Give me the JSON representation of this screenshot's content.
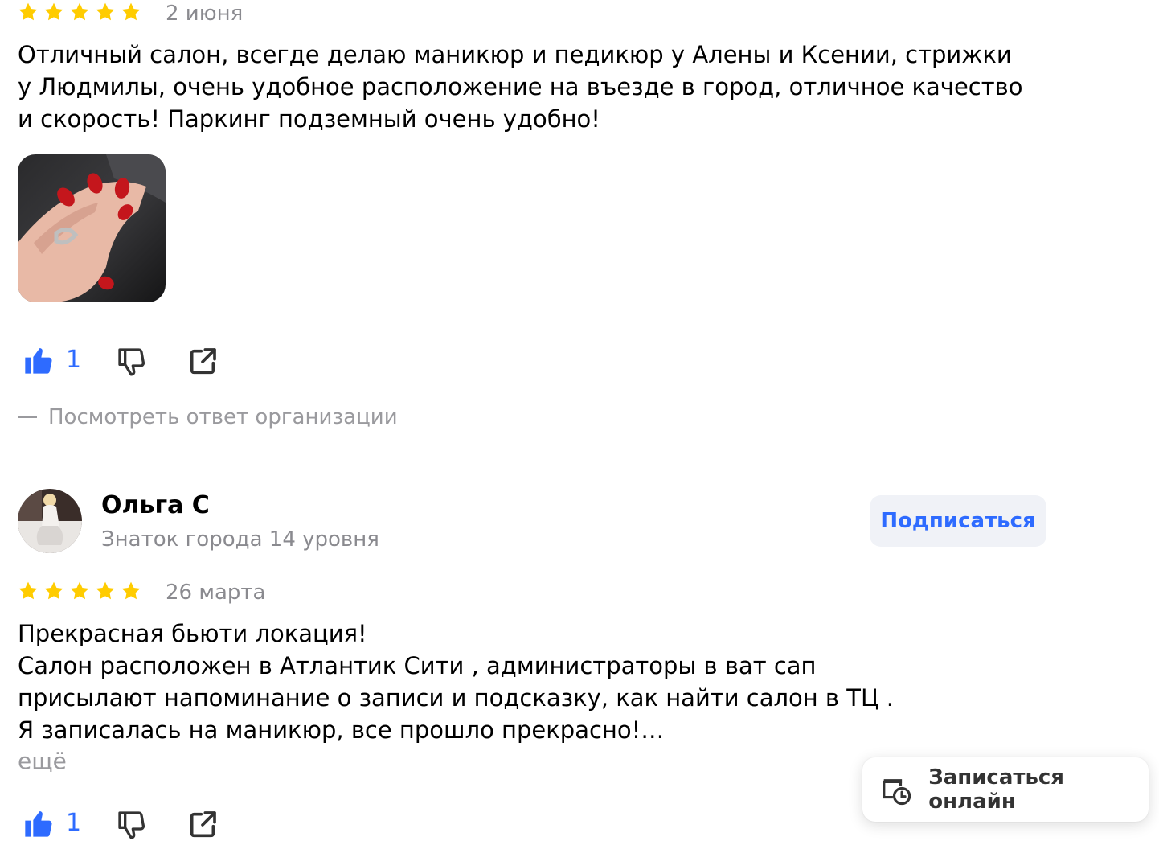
{
  "review1": {
    "rating": 5,
    "date": "2 июня",
    "text": "Отличный салон, всегде делаю маникюр и педикюр у Алены и Ксении, стрижки у Людмилы, очень удобное расположение на въезде в город, отличное качество и скорость! Паркинг подземный очень удобно!",
    "likes": "1",
    "reply_link": "Посмотреть ответ организации"
  },
  "review2": {
    "author": "Ольга С",
    "level": "Знаток города 14 уровня",
    "subscribe": "Подписаться",
    "rating": 5,
    "date": "26 марта",
    "text_lines": [
      "Прекрасная бьюти локация!",
      "Салон расположен в Атлантик Сити , администраторы в ват сап присылают напоминание о записи и подсказку, как найти салон в ТЦ .",
      "Я записалась на маникюр, все прошло прекрасно!…"
    ],
    "more": "ещё",
    "likes": "1"
  },
  "booking": {
    "label": "Записаться онлайн"
  },
  "colors": {
    "star": "#ffcc00",
    "accent": "#2e6bff",
    "muted": "#8a8a8f"
  },
  "icons": [
    "star-icon",
    "thumbs-up-icon",
    "thumbs-down-icon",
    "share-icon",
    "calendar-clock-icon"
  ]
}
